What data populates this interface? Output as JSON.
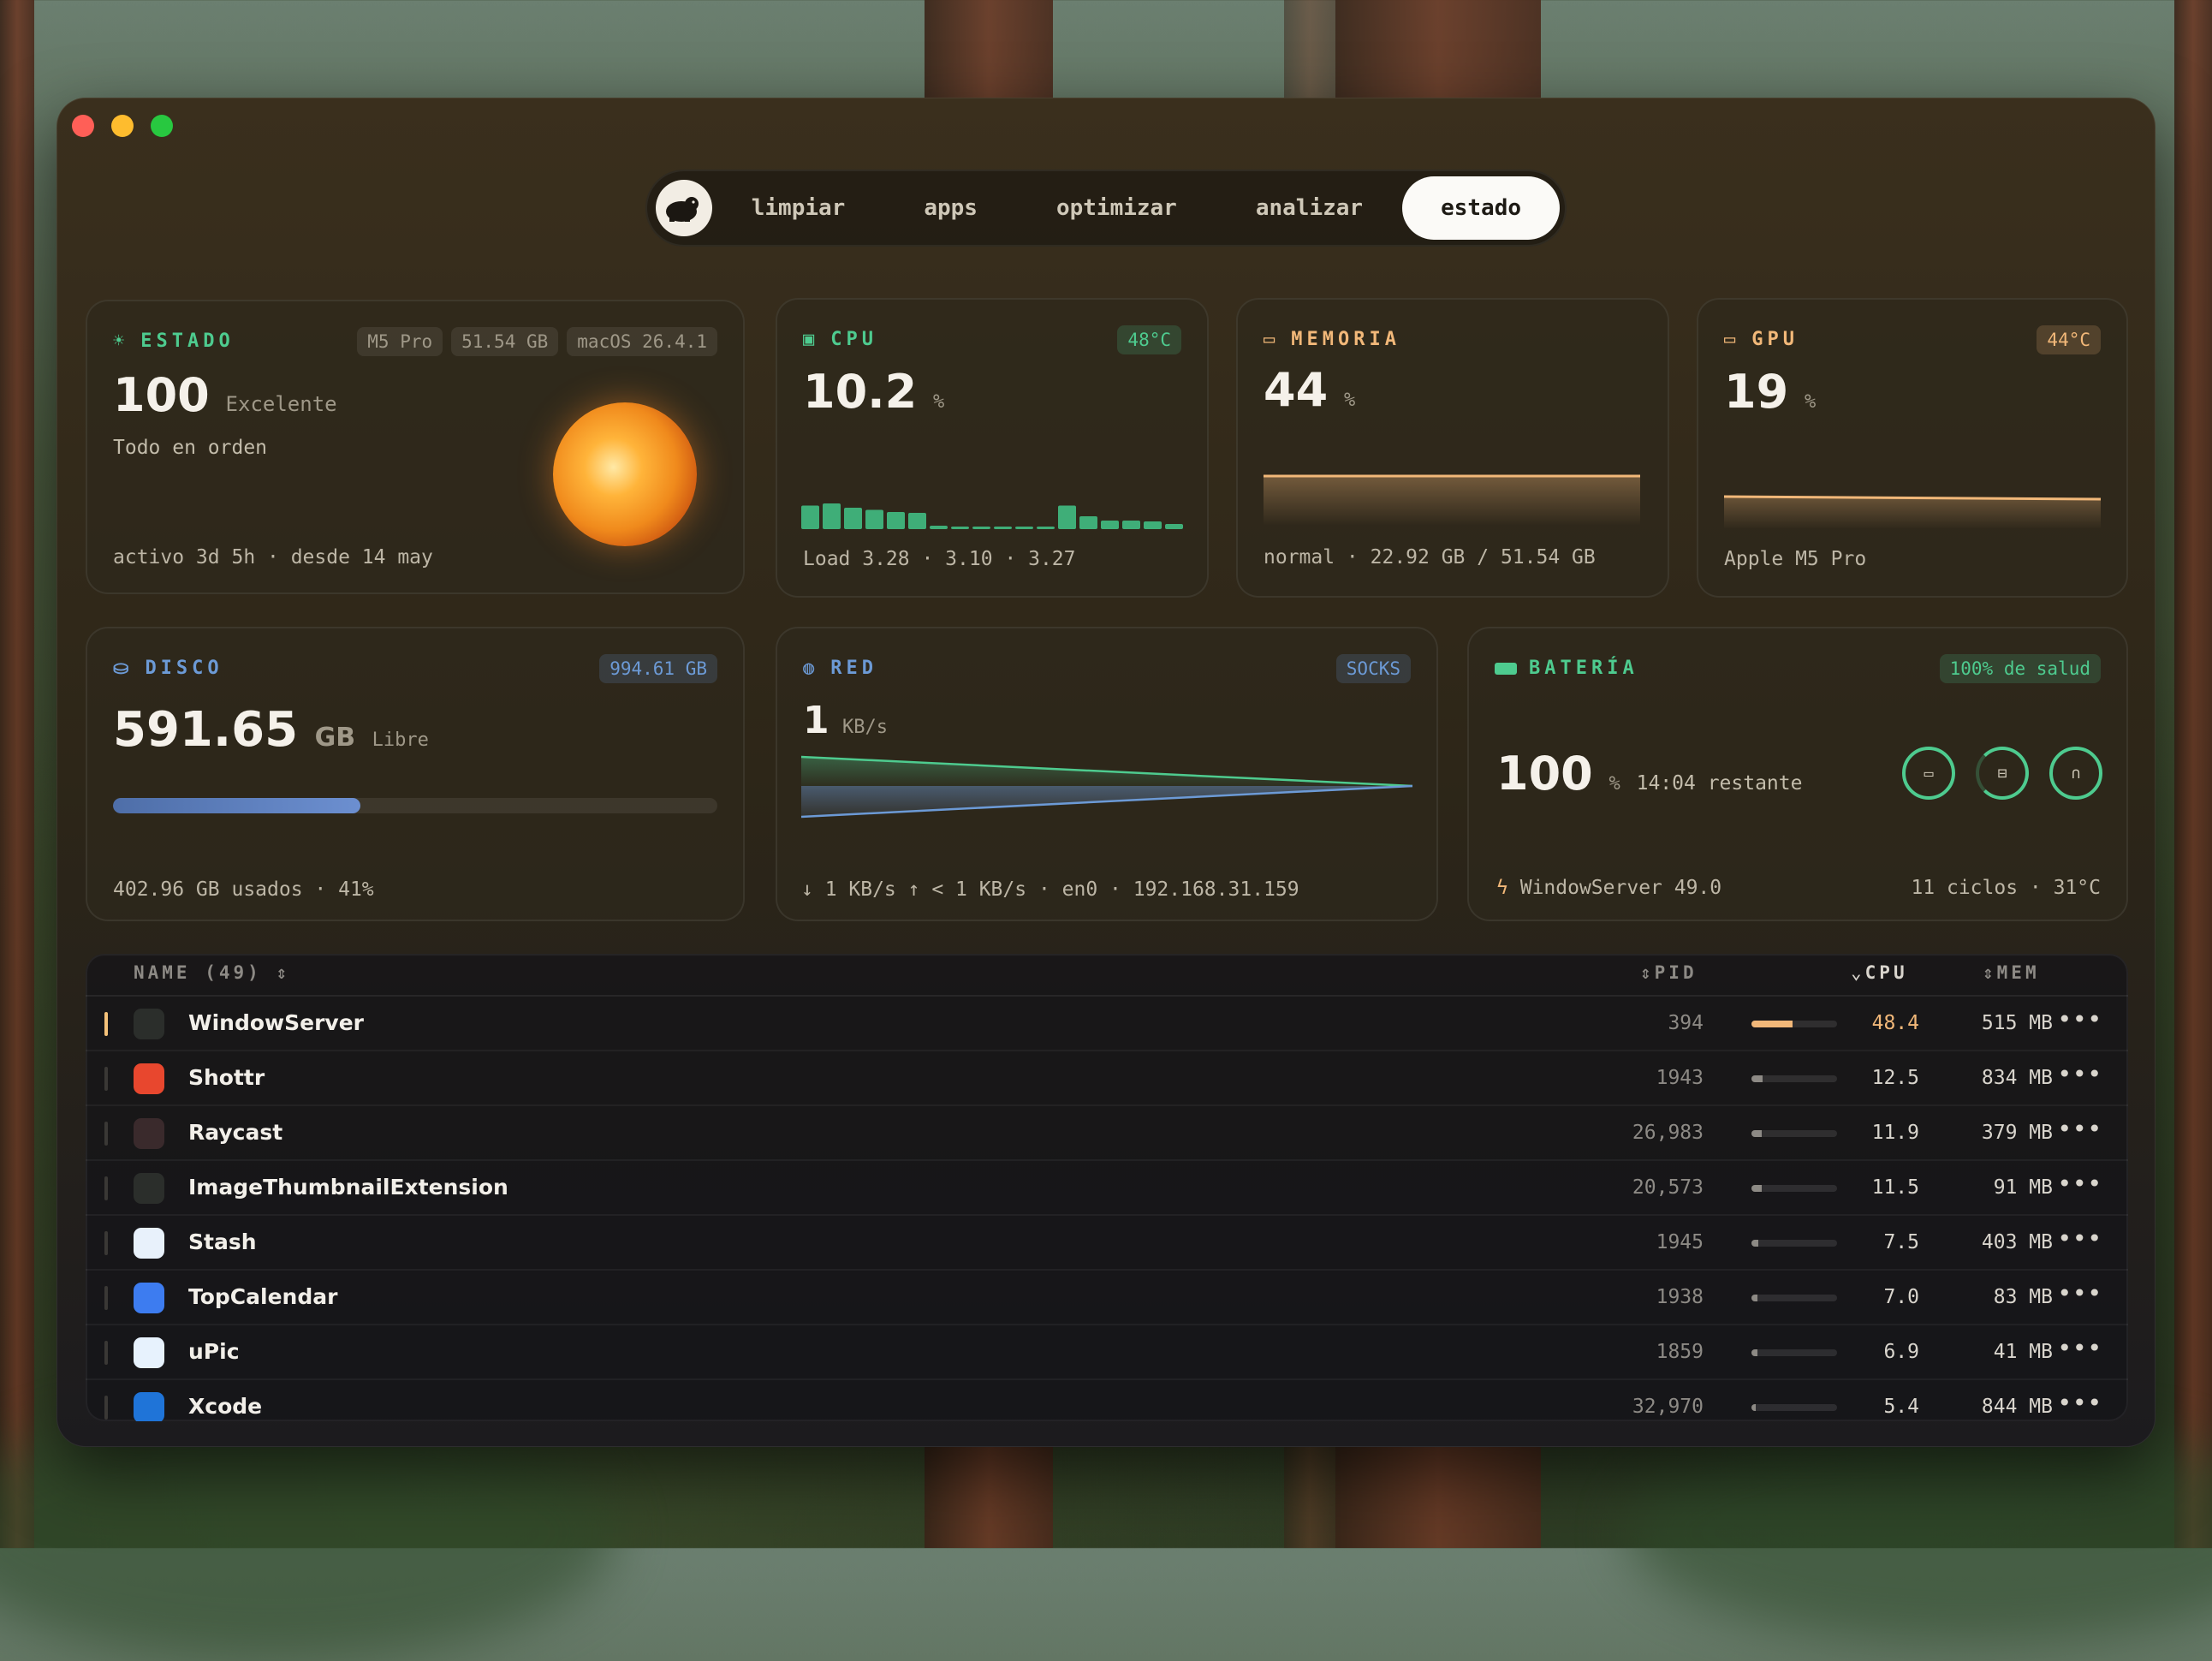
{
  "nav": {
    "tabs": [
      "limpiar",
      "apps",
      "optimizar",
      "analizar",
      "estado"
    ],
    "active": "estado"
  },
  "estado": {
    "title": "ESTADO",
    "pills": [
      "M5 Pro",
      "51.54 GB",
      "macOS 26.4.1"
    ],
    "score": "100",
    "score_label": "Excelente",
    "status": "Todo en orden",
    "uptime": "activo 3d 5h · desde 14 may"
  },
  "cpu": {
    "title": "CPU",
    "temp": "48°C",
    "value": "10.2",
    "unit": "%",
    "load": "Load 3.28 · 3.10 · 3.27",
    "bars": [
      0.55,
      0.6,
      0.5,
      0.45,
      0.4,
      0.38,
      0.08,
      0.06,
      0.06,
      0.06,
      0.06,
      0.06,
      0.55,
      0.3,
      0.2,
      0.2,
      0.18,
      0.12
    ]
  },
  "memoria": {
    "title": "MEMORIA",
    "value": "44",
    "unit": "%",
    "footer": "normal · 22.92 GB / 51.54 GB"
  },
  "gpu": {
    "title": "GPU",
    "temp": "44°C",
    "value": "19",
    "unit": "%",
    "footer": "Apple M5 Pro"
  },
  "disco": {
    "title": "DISCO",
    "capacity": "994.61 GB",
    "value": "591.65",
    "unit": "GB",
    "unit_label": "Libre",
    "used_fraction": 0.41,
    "footer": "402.96 GB usados · 41%"
  },
  "red": {
    "title": "RED",
    "badge": "SOCKS",
    "value": "1",
    "unit": "KB/s",
    "footer": "↓ 1 KB/s  ↑ < 1 KB/s · en0 · 192.168.31.159"
  },
  "bateria": {
    "title": "BATERÍA",
    "health": "100% de salud",
    "value": "100",
    "unit": "%",
    "remaining": "14:04 restante",
    "top_app": "WindowServer 49.0",
    "cycles": "11 ciclos · 31°C"
  },
  "table": {
    "headers": {
      "name": "NAME (49)",
      "pid": "PID",
      "cpu": "CPU",
      "mem": "MEM"
    },
    "rows": [
      {
        "name": "WindowServer",
        "pid": "394",
        "cpu": "48.4",
        "cpu_fraction": 0.48,
        "mem": "515 MB",
        "icon": "activity-monitor-icon",
        "color": "#2b2e2b"
      },
      {
        "name": "Shottr",
        "pid": "1943",
        "cpu": "12.5",
        "cpu_fraction": 0.125,
        "mem": "834 MB",
        "icon": "shottr-icon",
        "color": "#e8472e"
      },
      {
        "name": "Raycast",
        "pid": "26,983",
        "cpu": "11.9",
        "cpu_fraction": 0.119,
        "mem": "379 MB",
        "icon": "raycast-icon",
        "color": "#3a2a2c"
      },
      {
        "name": "ImageThumbnailExtension",
        "pid": "20,573",
        "cpu": "11.5",
        "cpu_fraction": 0.115,
        "mem": "91 MB",
        "icon": "activity-monitor-icon",
        "color": "#2b2e2b"
      },
      {
        "name": "Stash",
        "pid": "1945",
        "cpu": "7.5",
        "cpu_fraction": 0.075,
        "mem": "403 MB",
        "icon": "stash-icon",
        "color": "#e8f1fb"
      },
      {
        "name": "TopCalendar",
        "pid": "1938",
        "cpu": "7.0",
        "cpu_fraction": 0.07,
        "mem": "83 MB",
        "icon": "calendar-icon",
        "color": "#3d7cf0"
      },
      {
        "name": "uPic",
        "pid": "1859",
        "cpu": "6.9",
        "cpu_fraction": 0.069,
        "mem": "41 MB",
        "icon": "upic-icon",
        "color": "#e7f2fd"
      },
      {
        "name": "Xcode",
        "pid": "32,970",
        "cpu": "5.4",
        "cpu_fraction": 0.054,
        "mem": "844 MB",
        "icon": "xcode-icon",
        "color": "#1f74d8"
      }
    ]
  },
  "colors": {
    "accent_green": "#4ecb8f",
    "accent_orange": "#f2b879",
    "accent_blue": "#6c9ad6",
    "disk_blue": "#5f85c4"
  }
}
